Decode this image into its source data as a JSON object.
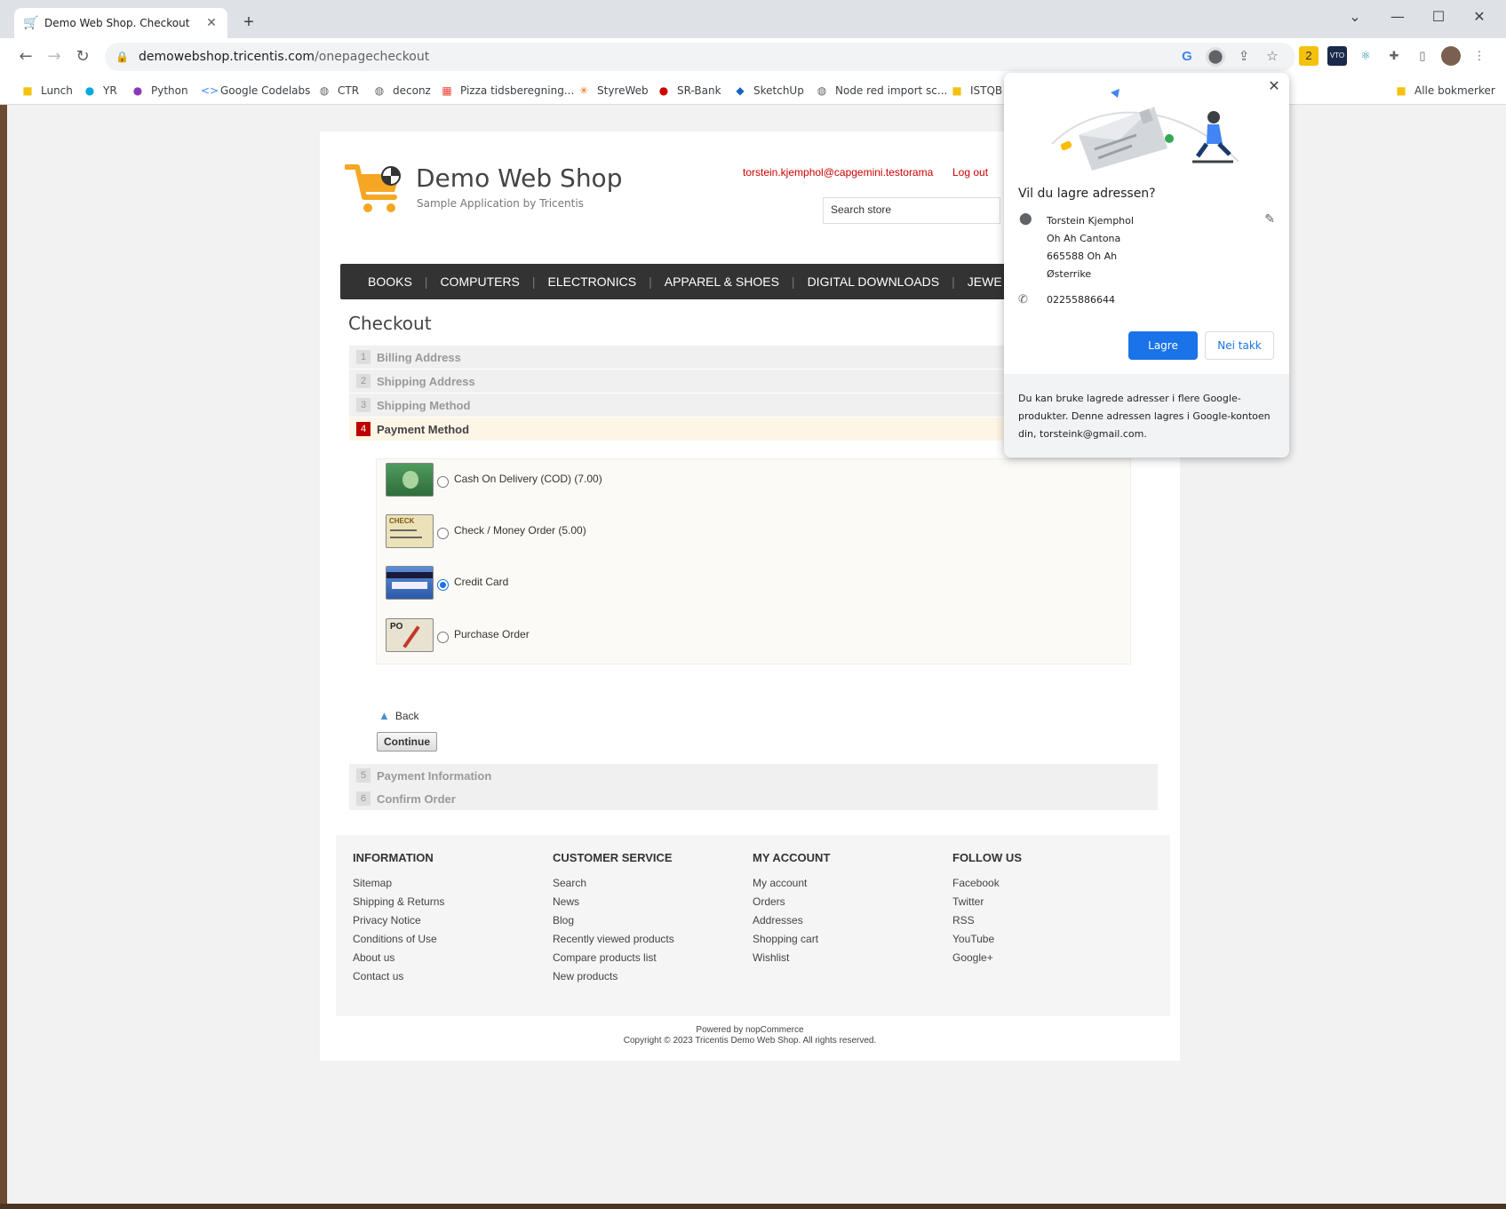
{
  "browser": {
    "tab_title": "Demo Web Shop. Checkout",
    "url_host": "demowebshop.tricentis.com",
    "url_path": "/onepagecheckout",
    "bookmarks": [
      "Lunch",
      "YR",
      "Python",
      "Google Codelabs",
      "CTR",
      "deconz",
      "Pizza tidsberegning...",
      "StyreWeb",
      "SR-Bank",
      "SketchUp",
      "Node red import sc...",
      "ISTQB"
    ],
    "all_bookmarks": "Alle bokmerker",
    "ext_badge": "2",
    "ext_vto": "VTO"
  },
  "shop": {
    "name": "Demo Web Shop",
    "subtitle": "Sample Application by Tricentis",
    "account_email": "torstein.kjemphol@capgemini.testorama",
    "logout": "Log out",
    "search_placeholder": "Search store",
    "menu": [
      "BOOKS",
      "COMPUTERS",
      "ELECTRONICS",
      "APPAREL & SHOES",
      "DIGITAL DOWNLOADS",
      "JEWE"
    ]
  },
  "checkout": {
    "title": "Checkout",
    "steps": [
      {
        "num": "1",
        "label": "Billing Address"
      },
      {
        "num": "2",
        "label": "Shipping Address"
      },
      {
        "num": "3",
        "label": "Shipping Method"
      },
      {
        "num": "4",
        "label": "Payment Method"
      },
      {
        "num": "5",
        "label": "Payment Information"
      },
      {
        "num": "6",
        "label": "Confirm Order"
      }
    ],
    "payment_methods": [
      {
        "label": "Cash On Delivery (COD) (7.00)",
        "selected": false
      },
      {
        "label": "Check / Money Order (5.00)",
        "selected": false
      },
      {
        "label": "Credit Card",
        "selected": true
      },
      {
        "label": "Purchase Order",
        "selected": false
      }
    ],
    "pm_img_check": "CHECK",
    "pm_img_po": "PO",
    "back": "Back",
    "continue": "Continue"
  },
  "footer": {
    "columns": [
      {
        "title": "INFORMATION",
        "links": [
          "Sitemap",
          "Shipping & Returns",
          "Privacy Notice",
          "Conditions of Use",
          "About us",
          "Contact us"
        ]
      },
      {
        "title": "CUSTOMER SERVICE",
        "links": [
          "Search",
          "News",
          "Blog",
          "Recently viewed products",
          "Compare products list",
          "New products"
        ]
      },
      {
        "title": "MY ACCOUNT",
        "links": [
          "My account",
          "Orders",
          "Addresses",
          "Shopping cart",
          "Wishlist"
        ]
      },
      {
        "title": "FOLLOW US",
        "links": [
          "Facebook",
          "Twitter",
          "RSS",
          "YouTube",
          "Google+"
        ]
      }
    ],
    "powered": "Powered by nopCommerce",
    "copyright": "Copyright © 2023 Tricentis Demo Web Shop. All rights reserved."
  },
  "address_popup": {
    "question": "Vil du lagre adressen?",
    "name": "Torstein Kjemphol",
    "line1": "Oh Ah Cantona",
    "line2": "665588 Oh Ah",
    "country": "Østerrike",
    "phone": "02255886644",
    "save": "Lagre",
    "no_thanks": "Nei takk",
    "info": "Du kan bruke lagrede adresser i flere Google-produkter. Denne adressen lagres i Google-kontoen din, torsteink@gmail.com."
  },
  "colors": {
    "accent_blue": "#1a73e8",
    "menu_bg": "#333333",
    "active_step": "#bb0000",
    "link_red": "#cc0000",
    "cart_orange": "#f5a623"
  }
}
